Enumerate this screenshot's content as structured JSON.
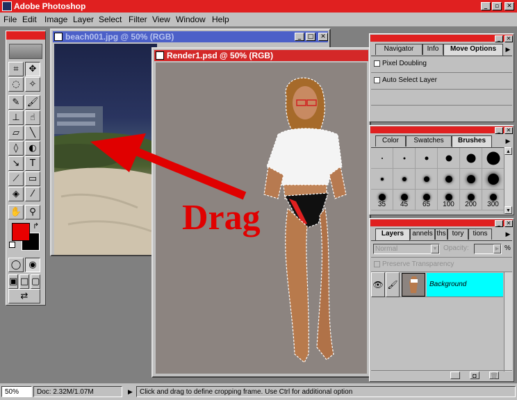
{
  "app": {
    "title": "Adobe Photoshop",
    "window_controls": [
      "_",
      "▫",
      "✕"
    ]
  },
  "menu": {
    "items": [
      "File",
      "Edit",
      "Image",
      "Layer",
      "Select",
      "Filter",
      "View",
      "Window",
      "Help"
    ]
  },
  "toolbox": {
    "foreground_color": "#e80000",
    "background_color": "#000000",
    "tools": [
      "crop-tool",
      "move-tool",
      "lasso-tool",
      "magic-wand-tool",
      "airbrush-tool",
      "paintbrush-tool",
      "rubber-stamp-tool",
      "smudge-tool",
      "eraser-tool",
      "line-tool",
      "blur-tool",
      "dodge-tool",
      "pen-tool",
      "type-tool",
      "gradient-tool",
      "measure-tool",
      "paint-bucket-tool",
      "eyedropper-tool",
      "hand-tool",
      "zoom-tool"
    ]
  },
  "documents": {
    "beach": {
      "title": "beach001.jpg @ 50% (RGB)",
      "controls": [
        "_",
        "□",
        "✕"
      ]
    },
    "render": {
      "title": "Render1.psd @ 50% (RGB)"
    }
  },
  "annotation": {
    "text": "Drag",
    "color": "#e00000"
  },
  "options_palette": {
    "tabs": [
      "Navigator",
      "Info",
      "Move Options"
    ],
    "active_tab": "Move Options",
    "checkboxes": [
      {
        "label": "Pixel Doubling",
        "checked": false
      },
      {
        "label": "Auto Select Layer",
        "checked": false
      }
    ]
  },
  "brushes_palette": {
    "tabs": [
      "Color",
      "Swatches",
      "Brushes"
    ],
    "active_tab": "Brushes",
    "brush_labels": [
      "35",
      "45",
      "65",
      "100",
      "200",
      "300"
    ]
  },
  "layers_palette": {
    "tabs": [
      "Layers",
      "annels",
      "ths",
      "tory",
      "tions"
    ],
    "active_tab": "Layers",
    "blend_mode": "Normal",
    "opacity_label": "Opacity:",
    "opacity_unit": "%",
    "preserve_transparency_label": "Preserve Transparency",
    "layer_name": "Background",
    "layer_highlight": "#00ffff"
  },
  "status": {
    "zoom": "50%",
    "doc_size": "Doc: 2.32M/1.07M",
    "hint": "Click and drag to define cropping frame. Use Ctrl for additional option"
  }
}
